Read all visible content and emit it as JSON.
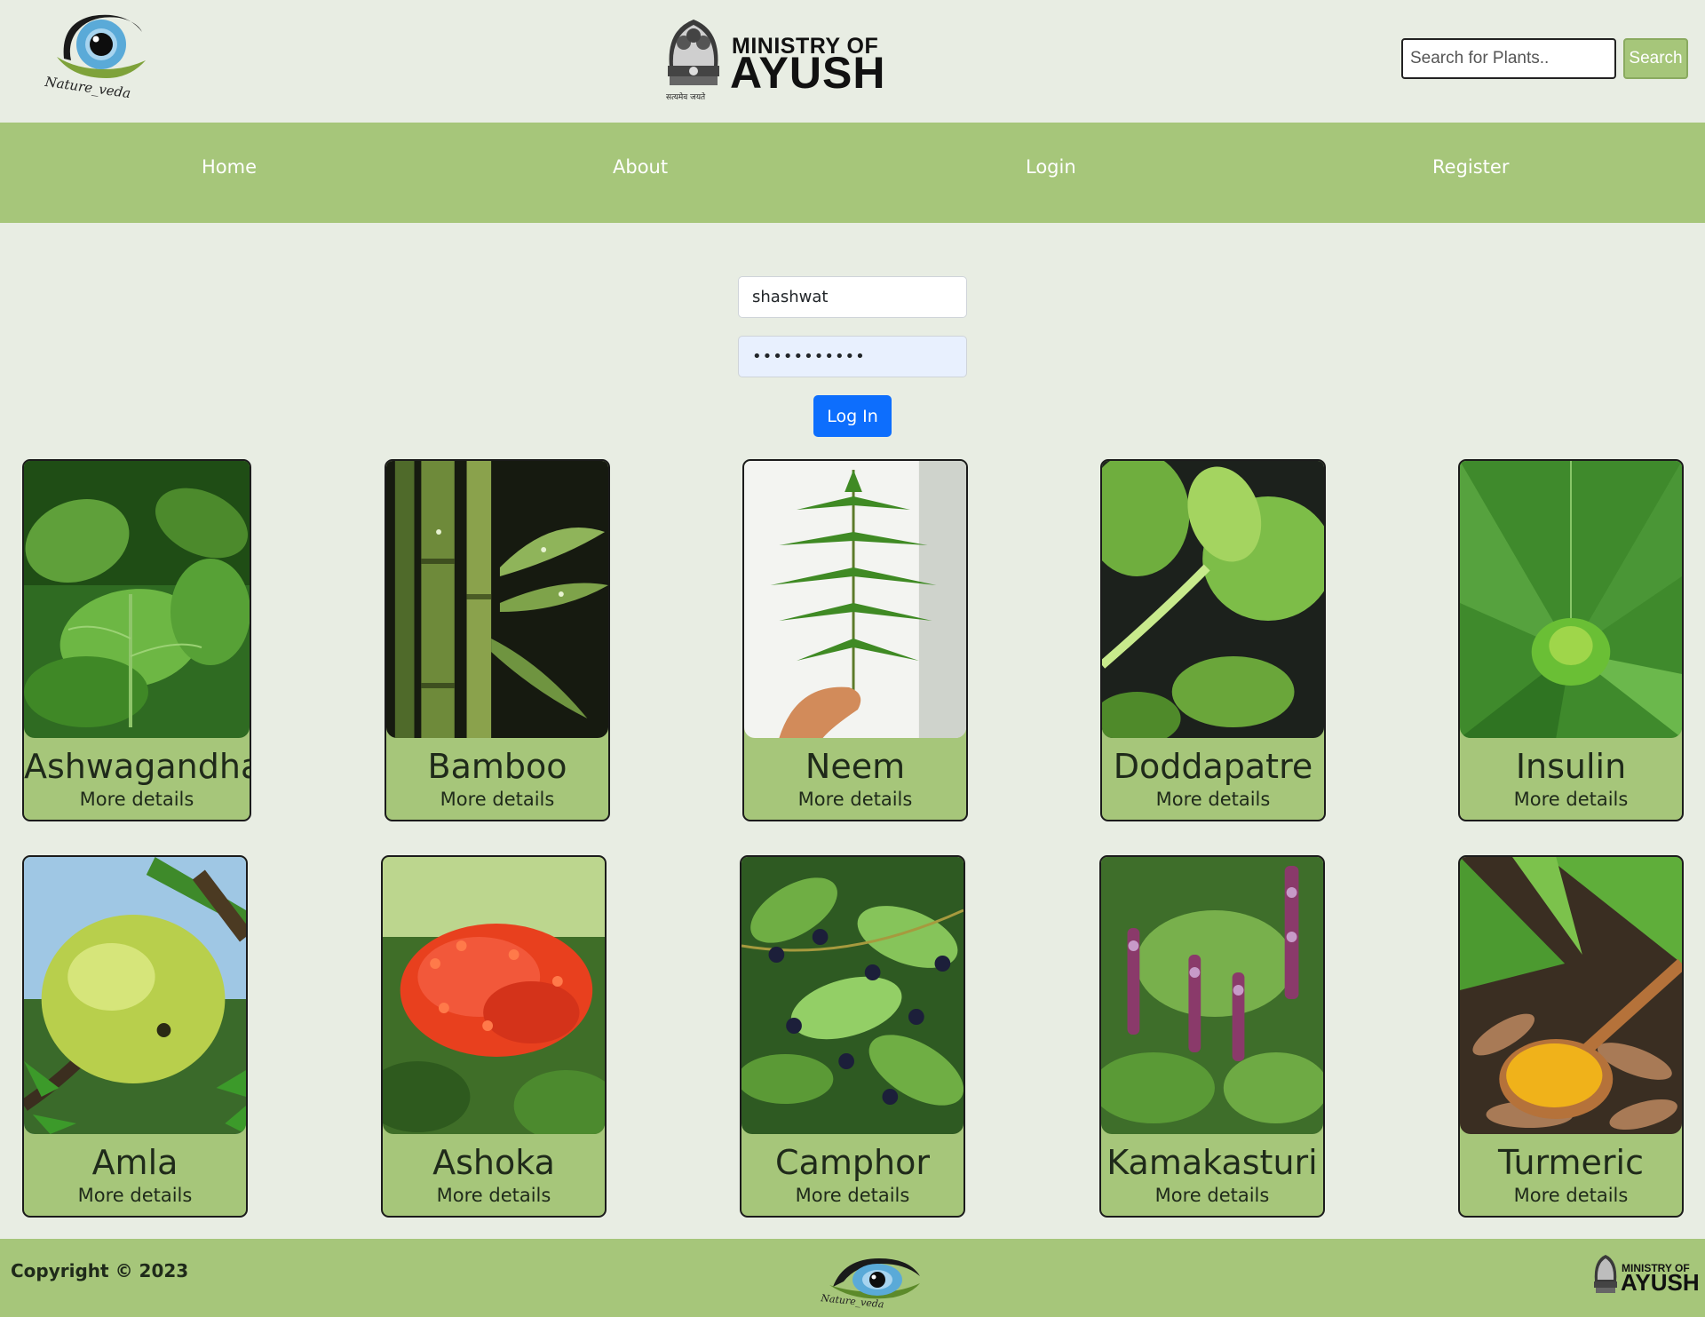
{
  "header": {
    "brand_logo_text": "Nature_veda",
    "ministry_top": "MINISTRY OF",
    "ministry_main": "AYUSH",
    "emblem_caption": "सत्यमेव जयते",
    "search": {
      "placeholder": "Search for Plants..",
      "button_label": "Search"
    }
  },
  "nav": {
    "items": [
      {
        "label": "Home"
      },
      {
        "label": "About"
      },
      {
        "label": "Login"
      },
      {
        "label": "Register"
      }
    ]
  },
  "login": {
    "username_value": "shashwat",
    "password_value": "•••••••••••",
    "button_label": "Log In"
  },
  "cards": [
    {
      "title": "Ashwagandha",
      "link": "More details",
      "image": "ashwagandha-leaves"
    },
    {
      "title": "Bamboo",
      "link": "More details",
      "image": "bamboo-stalks"
    },
    {
      "title": "Neem",
      "link": "More details",
      "image": "neem-leaf"
    },
    {
      "title": "Doddapatre",
      "link": "More details",
      "image": "doddapatre-leaves"
    },
    {
      "title": "Insulin",
      "link": "More details",
      "image": "insulin-plant"
    },
    {
      "title": "Amla",
      "link": "More details",
      "image": "amla-fruit"
    },
    {
      "title": "Ashoka",
      "link": "More details",
      "image": "ashoka-flower"
    },
    {
      "title": "Camphor",
      "link": "More details",
      "image": "camphor-berries"
    },
    {
      "title": "Kamakasturi",
      "link": "More details",
      "image": "kamakasturi-flowers"
    },
    {
      "title": "Turmeric",
      "link": "More details",
      "image": "turmeric-roots"
    }
  ],
  "footer": {
    "copyright": "Copyright © 2023",
    "logo_text": "Nature_veda",
    "ministry_top": "MINISTRY OF",
    "ministry_main": "AYUSH"
  },
  "colors": {
    "accent": "#a6c67a",
    "background": "#e8ede3",
    "primary_button": "#0d6efd"
  }
}
